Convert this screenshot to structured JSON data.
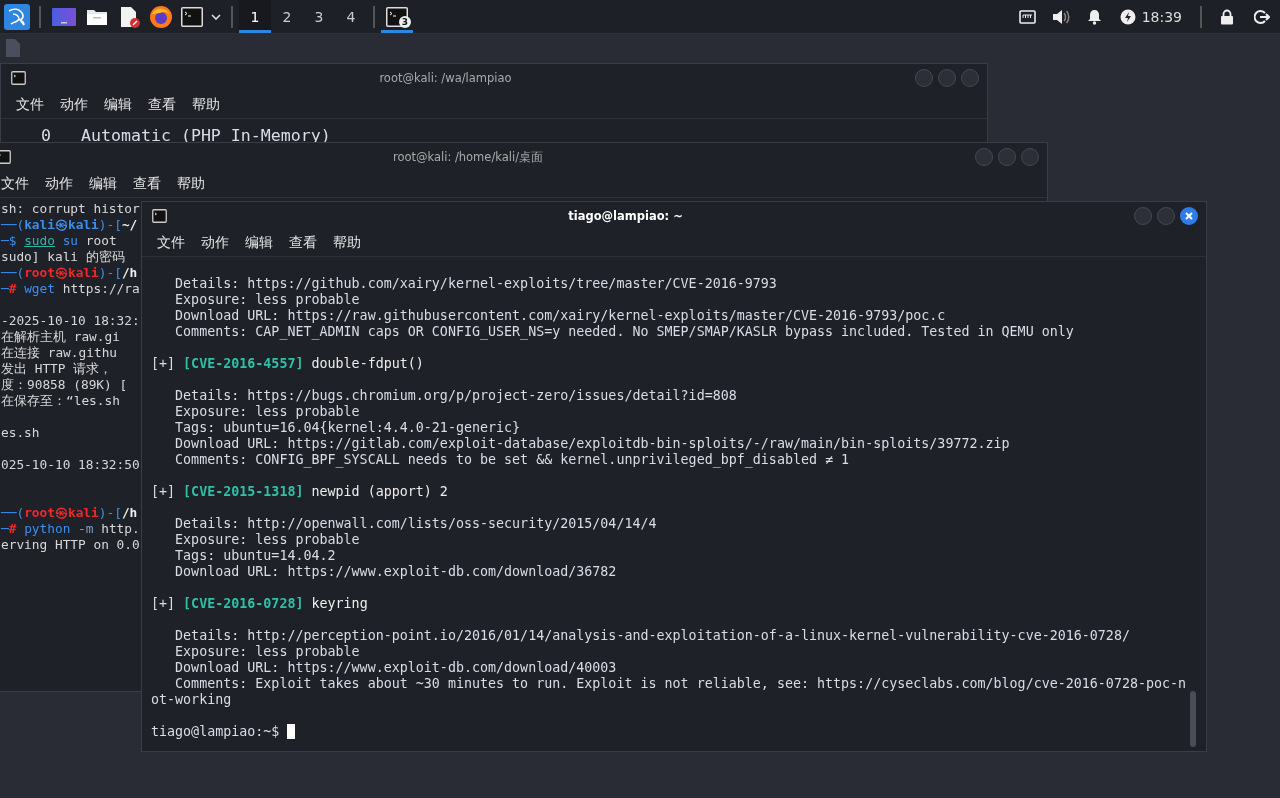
{
  "taskbar": {
    "workspaces": [
      {
        "label": "1",
        "selected": true
      },
      {
        "label": "2",
        "selected": false
      },
      {
        "label": "3",
        "selected": false
      },
      {
        "label": "4",
        "selected": false
      }
    ],
    "task": {
      "badge": "3",
      "selected": true
    },
    "clock": "18:39"
  },
  "windows": [
    {
      "title": "root@kali: /wa/lampiao",
      "active": false,
      "menu": [
        "文件",
        "动作",
        "编辑",
        "查看",
        "帮助"
      ],
      "lines": [
        {
          "kind": "option",
          "number": "0",
          "label": "Automatic (PHP In-Memory)"
        }
      ]
    },
    {
      "title": "root@kali: /home/kali/桌面",
      "active": false,
      "menu": [
        "文件",
        "动作",
        "编辑",
        "查看",
        "帮助"
      ],
      "lines": [
        {
          "kind": "text",
          "segments": [
            {
              "kind": "plain",
              "text": "sh: corrupt histor"
            }
          ]
        },
        {
          "kind": "text",
          "segments": [
            {
              "kind": "frame",
              "text": "──("
            },
            {
              "kind": "user",
              "text": "kali㉿kali"
            },
            {
              "kind": "frame",
              "text": ")-["
            },
            {
              "kind": "path",
              "text": "~/"
            }
          ]
        },
        {
          "kind": "text",
          "segments": [
            {
              "kind": "frame",
              "text": "─$ "
            },
            {
              "kind": "cmd-ul",
              "text": "sudo"
            },
            {
              "kind": "cmd",
              "text": " su"
            },
            {
              "kind": "plain",
              "text": " root"
            }
          ]
        },
        {
          "kind": "text",
          "segments": [
            {
              "kind": "plain",
              "text": "sudo] kali 的密码"
            }
          ]
        },
        {
          "kind": "text",
          "segments": [
            {
              "kind": "frame",
              "text": "──("
            },
            {
              "kind": "root",
              "text": "root㉿kali"
            },
            {
              "kind": "frame",
              "text": ")-["
            },
            {
              "kind": "path",
              "text": "/h"
            }
          ]
        },
        {
          "kind": "text",
          "segments": [
            {
              "kind": "frame",
              "text": "─"
            },
            {
              "kind": "sym-root",
              "text": "# "
            },
            {
              "kind": "cmd",
              "text": "wget "
            },
            {
              "kind": "plain",
              "text": "https://ra"
            }
          ]
        },
        {
          "kind": "blank"
        },
        {
          "kind": "text",
          "segments": [
            {
              "kind": "plain",
              "text": "-2025-10-10 18:32:"
            }
          ]
        },
        {
          "kind": "text",
          "segments": [
            {
              "kind": "plain",
              "text": "在解析主机 raw.gi"
            }
          ]
        },
        {
          "kind": "text",
          "segments": [
            {
              "kind": "plain",
              "text": "在连接 raw.githu"
            }
          ]
        },
        {
          "kind": "text",
          "segments": [
            {
              "kind": "plain",
              "text": "发出 HTTP 请求，"
            }
          ]
        },
        {
          "kind": "text",
          "segments": [
            {
              "kind": "plain",
              "text": "度：90858 (89K) ["
            }
          ]
        },
        {
          "kind": "text",
          "segments": [
            {
              "kind": "plain",
              "text": "在保存至：“les.sh"
            }
          ]
        },
        {
          "kind": "blank"
        },
        {
          "kind": "text",
          "segments": [
            {
              "kind": "plain",
              "text": "es.sh"
            }
          ]
        },
        {
          "kind": "blank"
        },
        {
          "kind": "text",
          "segments": [
            {
              "kind": "plain",
              "text": "025-10-10 18:32:50"
            }
          ]
        },
        {
          "kind": "blank"
        },
        {
          "kind": "blank"
        },
        {
          "kind": "text",
          "segments": [
            {
              "kind": "frame",
              "text": "──("
            },
            {
              "kind": "root",
              "text": "root㉿kali"
            },
            {
              "kind": "frame",
              "text": ")-["
            },
            {
              "kind": "path",
              "text": "/h"
            }
          ]
        },
        {
          "kind": "text",
          "segments": [
            {
              "kind": "frame",
              "text": "─"
            },
            {
              "kind": "sym-root",
              "text": "# "
            },
            {
              "kind": "cmd",
              "text": "python "
            },
            {
              "kind": "opt",
              "text": "-m "
            },
            {
              "kind": "plain",
              "text": "http."
            }
          ]
        },
        {
          "kind": "text",
          "segments": [
            {
              "kind": "plain",
              "text": "erving HTTP on 0.0"
            }
          ]
        }
      ]
    },
    {
      "title": "tiago@lampiao: ~",
      "active": true,
      "menu": [
        "文件",
        "动作",
        "编辑",
        "查看",
        "帮助"
      ],
      "lines": [
        {
          "kind": "blank"
        },
        {
          "kind": "detail",
          "text": "Details: https://github.com/xairy/kernel-exploits/tree/master/CVE-2016-9793"
        },
        {
          "kind": "detail",
          "text": "Exposure: less probable"
        },
        {
          "kind": "detail",
          "text": "Download URL: https://raw.githubusercontent.com/xairy/kernel-exploits/master/CVE-2016-9793/poc.c"
        },
        {
          "kind": "detail",
          "text": "Comments: CAP_NET_ADMIN caps OR CONFIG_USER_NS=y needed. No SMEP/SMAP/KASLR bypass included. Tested in QEMU only"
        },
        {
          "kind": "blank"
        },
        {
          "kind": "heading",
          "marker": "[+]",
          "id": "[CVE-2016-4557]",
          "title": "double-fdput()"
        },
        {
          "kind": "blank"
        },
        {
          "kind": "detail",
          "text": "Details: https://bugs.chromium.org/p/project-zero/issues/detail?id=808"
        },
        {
          "kind": "detail",
          "text": "Exposure: less probable"
        },
        {
          "kind": "detail",
          "text": "Tags: ubuntu=16.04{kernel:4.4.0-21-generic}"
        },
        {
          "kind": "detail",
          "text": "Download URL: https://gitlab.com/exploit-database/exploitdb-bin-sploits/-/raw/main/bin-sploits/39772.zip"
        },
        {
          "kind": "detail",
          "text": "Comments: CONFIG_BPF_SYSCALL needs to be set && kernel.unprivileged_bpf_disabled ≠ 1"
        },
        {
          "kind": "blank"
        },
        {
          "kind": "heading",
          "marker": "[+]",
          "id": "[CVE-2015-1318]",
          "title": "newpid (apport) 2"
        },
        {
          "kind": "blank"
        },
        {
          "kind": "detail",
          "text": "Details: http://openwall.com/lists/oss-security/2015/04/14/4"
        },
        {
          "kind": "detail",
          "text": "Exposure: less probable"
        },
        {
          "kind": "detail",
          "text": "Tags: ubuntu=14.04.2"
        },
        {
          "kind": "detail",
          "text": "Download URL: https://www.exploit-db.com/download/36782"
        },
        {
          "kind": "blank"
        },
        {
          "kind": "heading",
          "marker": "[+]",
          "id": "[CVE-2016-0728]",
          "title": "keyring"
        },
        {
          "kind": "blank"
        },
        {
          "kind": "detail",
          "text": "Details: http://perception-point.io/2016/01/14/analysis-and-exploitation-of-a-linux-kernel-vulnerability-cve-2016-0728/"
        },
        {
          "kind": "detail",
          "text": "Exposure: less probable"
        },
        {
          "kind": "detail",
          "text": "Download URL: https://www.exploit-db.com/download/40003"
        },
        {
          "kind": "detail",
          "text": "Comments: Exploit takes about ~30 minutes to run. Exploit is not reliable, see: https://cyseclabs.com/blog/cve-2016-0728-poc-not-working"
        },
        {
          "kind": "blank"
        },
        {
          "kind": "prompt",
          "text": "tiago@lampiao:~$",
          "cursor": true
        }
      ]
    }
  ]
}
